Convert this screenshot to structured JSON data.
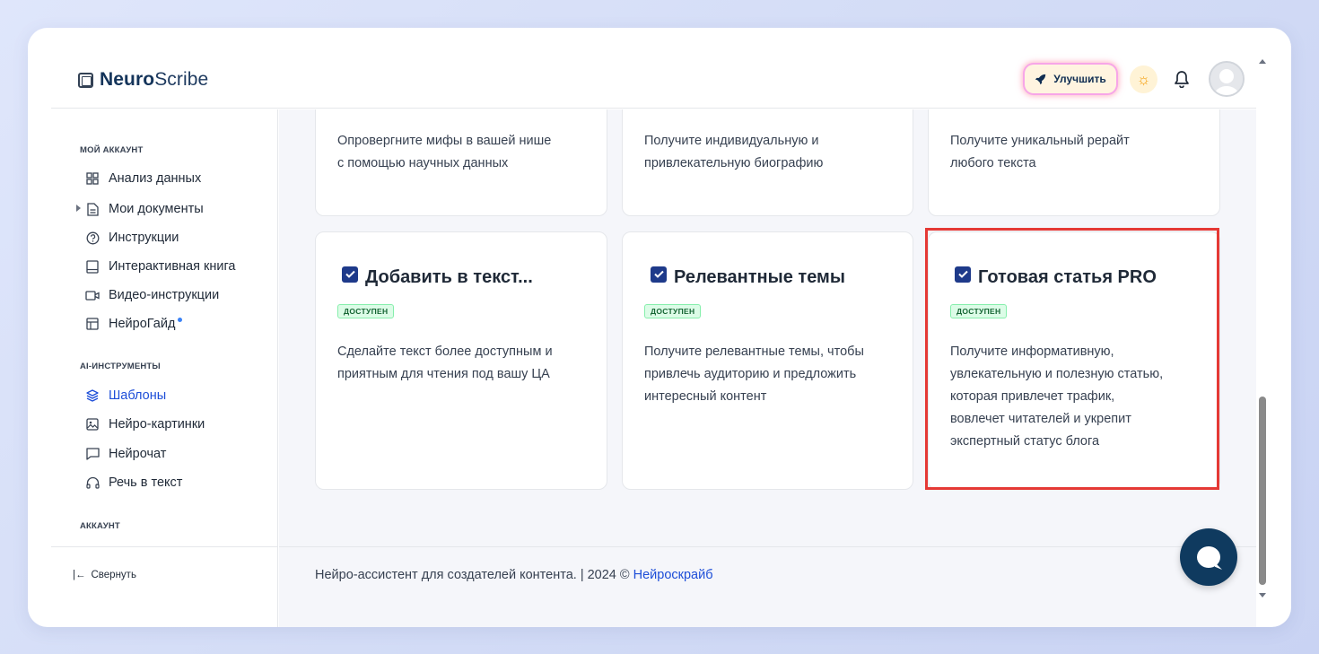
{
  "app": {
    "brand_bold": "Neuro",
    "brand_regular": "Scribe"
  },
  "header": {
    "upgrade_label": "Улучшить"
  },
  "sidebar": {
    "section_account": "МОЙ АККАУНТ",
    "account_items": [
      {
        "label": "Анализ данных"
      },
      {
        "label": "Мои документы"
      },
      {
        "label": "Инструкции"
      },
      {
        "label": "Интерактивная книга"
      },
      {
        "label": "Видео-инструкции"
      },
      {
        "label": "НейроГайд"
      }
    ],
    "section_ai": "AI-ИНСТРУМЕНТЫ",
    "ai_items": [
      {
        "label": "Шаблоны"
      },
      {
        "label": "Нейро-картинки"
      },
      {
        "label": "Нейрочат"
      },
      {
        "label": "Речь в текст"
      }
    ],
    "section_account2": "АККАУНТ",
    "collapse_label": "Свернуть"
  },
  "cards_top": [
    {
      "desc_line1": "Опровергните мифы в вашей нише",
      "desc_line2": "с помощью научных данных"
    },
    {
      "desc_line1": "Получите индивидуальную и",
      "desc_line2": "привлекательную биографию"
    },
    {
      "desc_line1": "Получите уникальный рерайт",
      "desc_line2": "любого текста"
    }
  ],
  "cards": [
    {
      "title": "Добавить в текст...",
      "badge": "ДОСТУПЕН",
      "desc": [
        "Сделайте текст более доступным и",
        "приятным для чтения под вашу ЦА"
      ]
    },
    {
      "title": "Релевантные темы",
      "badge": "ДОСТУПЕН",
      "desc": [
        "Получите релевантные темы, чтобы",
        "привлечь аудиторию и предложить",
        "интересный контент"
      ]
    },
    {
      "title": "Готовая статья PRO",
      "badge": "ДОСТУПЕН",
      "desc": [
        "Получите информативную,",
        "увлекательную и полезную статью,",
        "которая привлечет трафик,",
        "вовлечет читателей и укрепит",
        "экспертный статус блога"
      ]
    }
  ],
  "footer": {
    "text": "Нейро-ассистент для создателей контента.  | 2024 © ",
    "link": "Нейроскрайб"
  },
  "colors": {
    "accent": "#1d4ed8",
    "highlight": "#e53935",
    "badge_bg": "#dcfce7",
    "chat_button": "#0f3a5f"
  }
}
